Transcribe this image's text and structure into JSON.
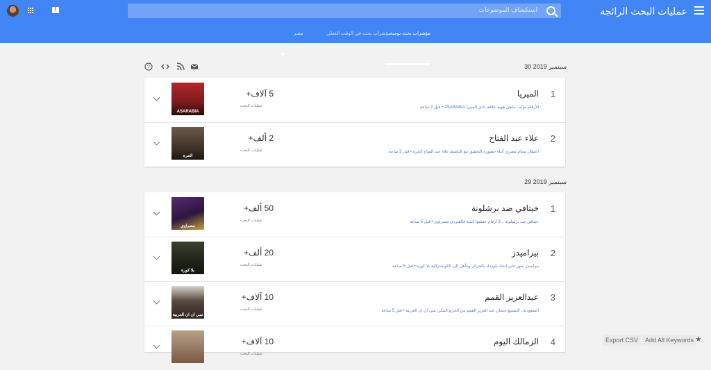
{
  "header": {
    "app_title": "عمليات البحث الرائجة",
    "search_placeholder": "استكشاف الموضوعات",
    "tabs": [
      {
        "label": "مؤشرات بحث يومية",
        "active": true
      },
      {
        "label": "مؤشرات بحث في الوقت الفعلي",
        "active": false
      },
      {
        "label": "مصر",
        "active": false
      }
    ]
  },
  "toolbar": {
    "icons": [
      "help-icon",
      "embed-icon",
      "rss-icon",
      "email-icon"
    ]
  },
  "groups": [
    {
      "date": "30 سبتمبر 2019",
      "items": [
        {
          "rank": "1",
          "title": "الميريا",
          "subtitle": "الأرقام تؤكد.. ماهي هوية علاقة نادي الميريا  ASARABIA • قبل 2 ساعة",
          "count": "5 آلاف+",
          "count_label": "عمليات البحث",
          "thumb_text": "ASARABIA"
        },
        {
          "rank": "2",
          "title": "علاء عبد الفتاح",
          "subtitle": "اعتقال محام مصري أثناء حضوره التحقيق مع الناشط علاء عبد الفتاح  الحرة • قبل 3 ساعة",
          "count": "2 ألف+",
          "count_label": "عمليات البحث",
          "thumb_text": "الحرة"
        }
      ]
    },
    {
      "date": "29 سبتمبر 2019",
      "items": [
        {
          "rank": "1",
          "title": "خيتافي ضد برشلونة",
          "subtitle": "خيتافي ضد برشلونة .. 3 أرقام حققتها كتيبة فالفيردي   مصراوي • قبل 5 ساعة",
          "count": "50 ألف+",
          "count_label": "عمليات البحث",
          "thumb_text": "مصراوي"
        },
        {
          "rank": "2",
          "title": "بيراميدز",
          "subtitle": "بيراميدز يفوز على إتحاد بلوزداد بالجزائر ويتأهل إلى الكونفدرالية  يلا كورة • قبل 5 ساعة",
          "count": "20 ألف+",
          "count_label": "عمليات البحث",
          "thumb_text": "يلا كورة"
        },
        {
          "rank": "3",
          "title": "عبدالعزيز القمم",
          "subtitle": "السعودية.. التشييع جثمان عبد العزيز القمم من الحرم المكي  سي ان ان العربية • قبل 5 ساعة",
          "count": "10 آلاف+",
          "count_label": "عمليات البحث",
          "thumb_text": "سي ان ان العربية"
        },
        {
          "rank": "4",
          "title": "الزمالك اليوم",
          "subtitle": "",
          "count": "10 آلاف+",
          "count_label": "عمليات البحث",
          "thumb_text": ""
        }
      ]
    }
  ],
  "footer": {
    "export_label": "Export CSV",
    "add_keywords_label": "Add All Keywords"
  },
  "colors": {
    "header_bg": "#4285f4",
    "page_bg": "#f2f2f2",
    "link": "#4f7ac7"
  }
}
